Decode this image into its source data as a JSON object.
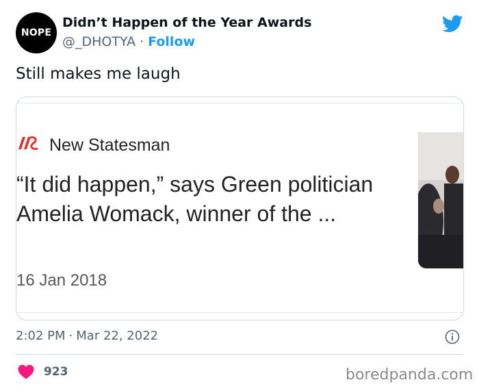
{
  "author": {
    "avatar_text": "NOPE",
    "display_name": "Didn’t Happen of the Year Awards",
    "handle": "@_DHOTYA",
    "separator": "·",
    "follow_label": "Follow"
  },
  "tweet": {
    "text": "Still makes me laugh"
  },
  "card": {
    "source": "New Statesman",
    "headline": "“It did happen,” says Green politician Amelia Womack, winner of the ...",
    "date": "16 Jan 2018"
  },
  "meta": {
    "time": "2:02 PM",
    "separator": "·",
    "date": "Mar 22, 2022"
  },
  "engagement": {
    "likes": "923"
  },
  "watermark": "boredpanda.com",
  "colors": {
    "twitter_blue": "#1d9bf0",
    "like_pink": "#f91880",
    "new_statesman_red": "#e5312b"
  },
  "icons": {
    "brand": "twitter-bird-icon",
    "info": "info-icon",
    "like": "heart-icon"
  }
}
